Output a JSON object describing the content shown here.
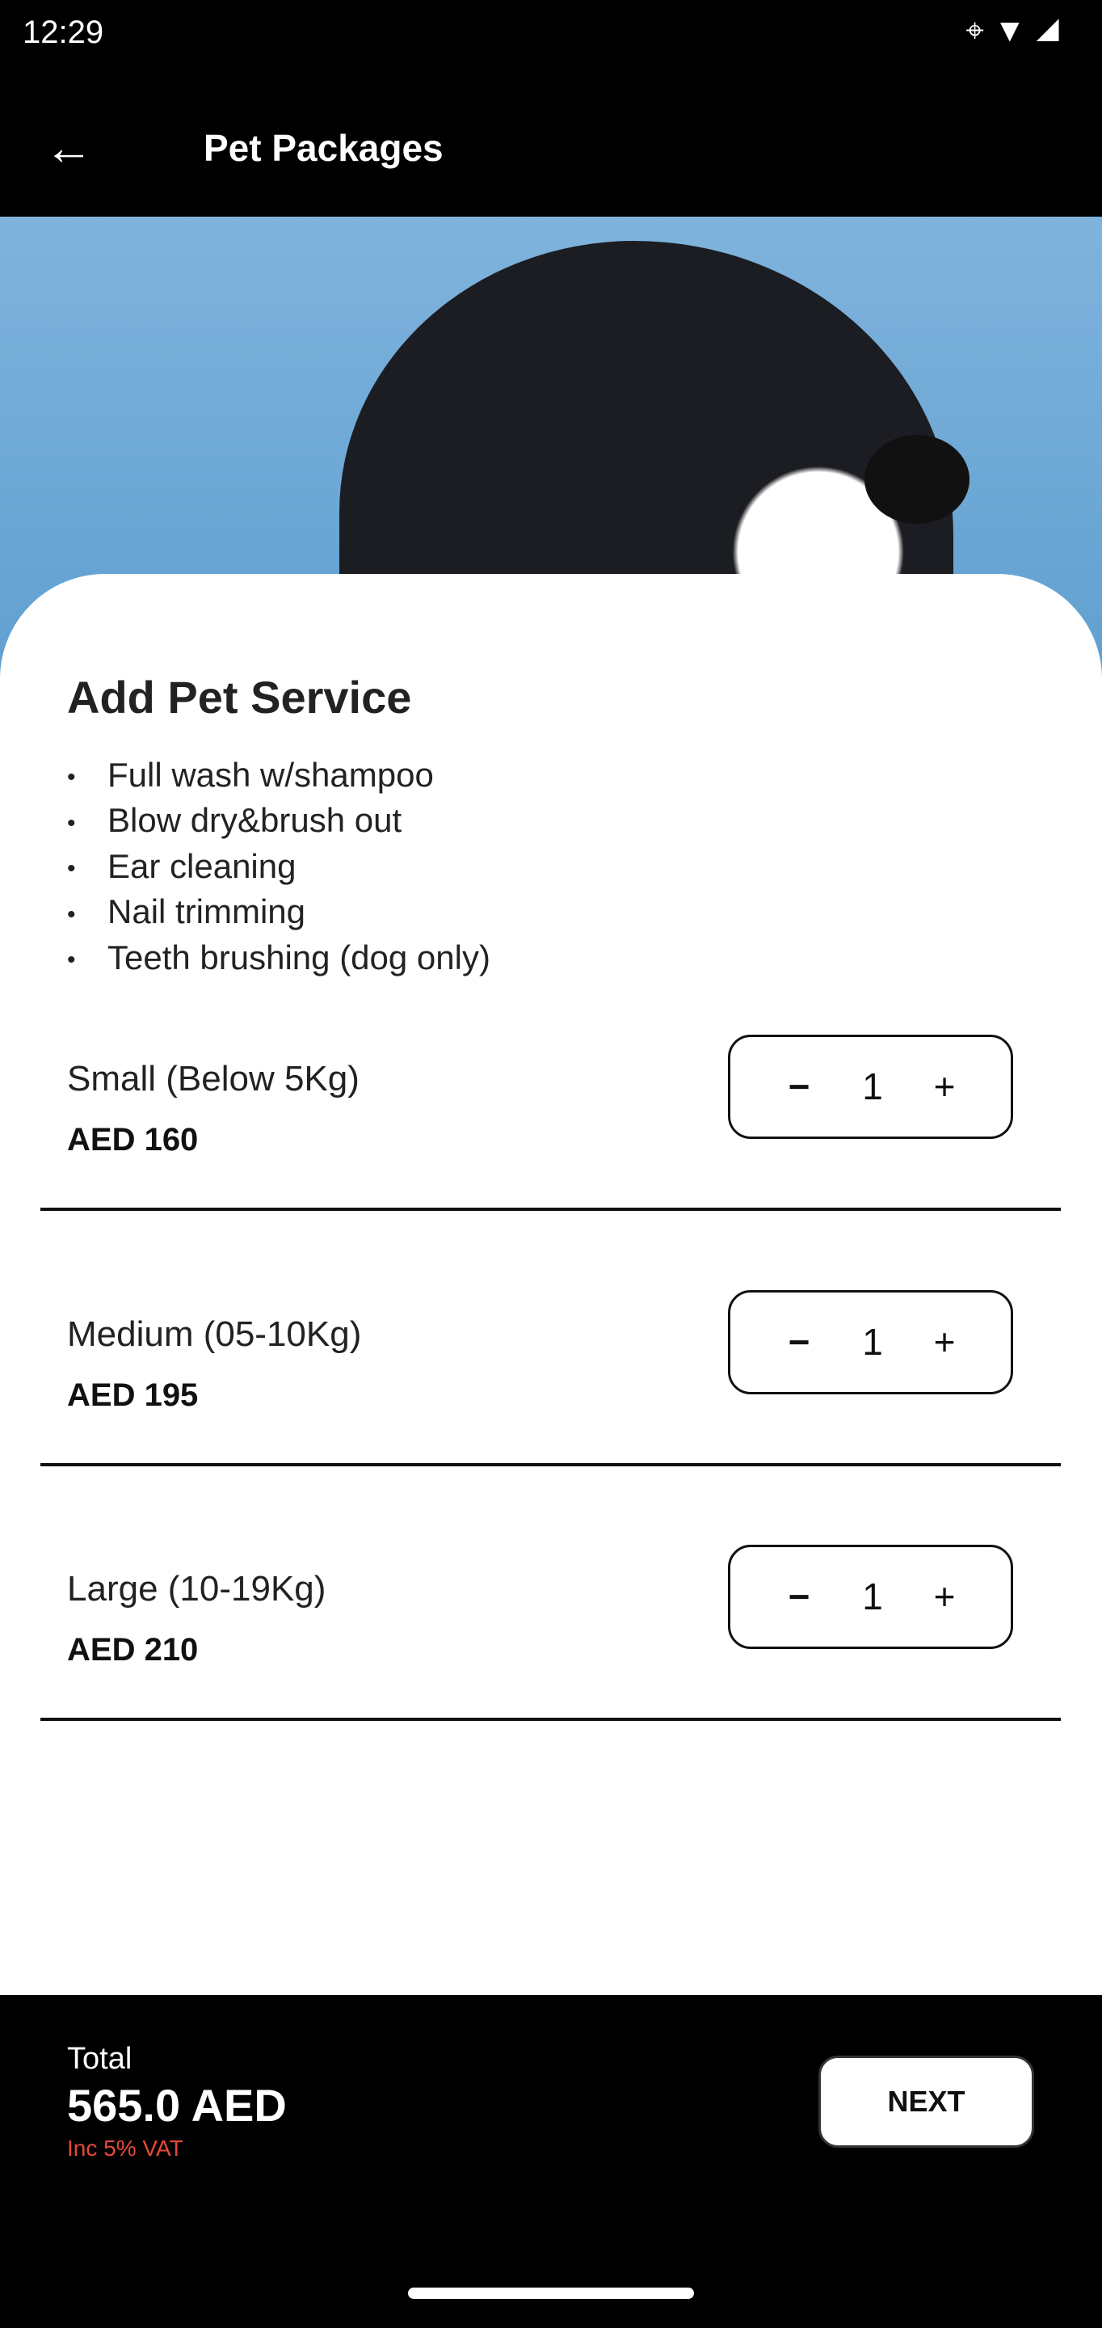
{
  "status_bar": {
    "time": "12:29",
    "icons": [
      "location-icon",
      "wifi-icon",
      "signal-icon"
    ]
  },
  "app_bar": {
    "title": "Pet Packages",
    "back_icon": "arrow-left-icon"
  },
  "content": {
    "heading": "Add Pet Service",
    "features": [
      "Full wash w/shampoo",
      "Blow dry&brush out",
      "Ear cleaning",
      "Nail trimming",
      "Teeth brushing (dog only)"
    ],
    "packages": [
      {
        "label": "Small (Below 5Kg)",
        "price": "AED 160",
        "quantity": "1"
      },
      {
        "label": "Medium (05-10Kg)",
        "price": "AED 195",
        "quantity": "1"
      },
      {
        "label": "Large (10-19Kg)",
        "price": "AED 210",
        "quantity": "1"
      }
    ]
  },
  "footer": {
    "total_label": "Total",
    "total_value": "565.0 AED",
    "vat_note": "Inc 5% VAT",
    "next_label": "NEXT",
    "vat_color": "#e5493a"
  }
}
